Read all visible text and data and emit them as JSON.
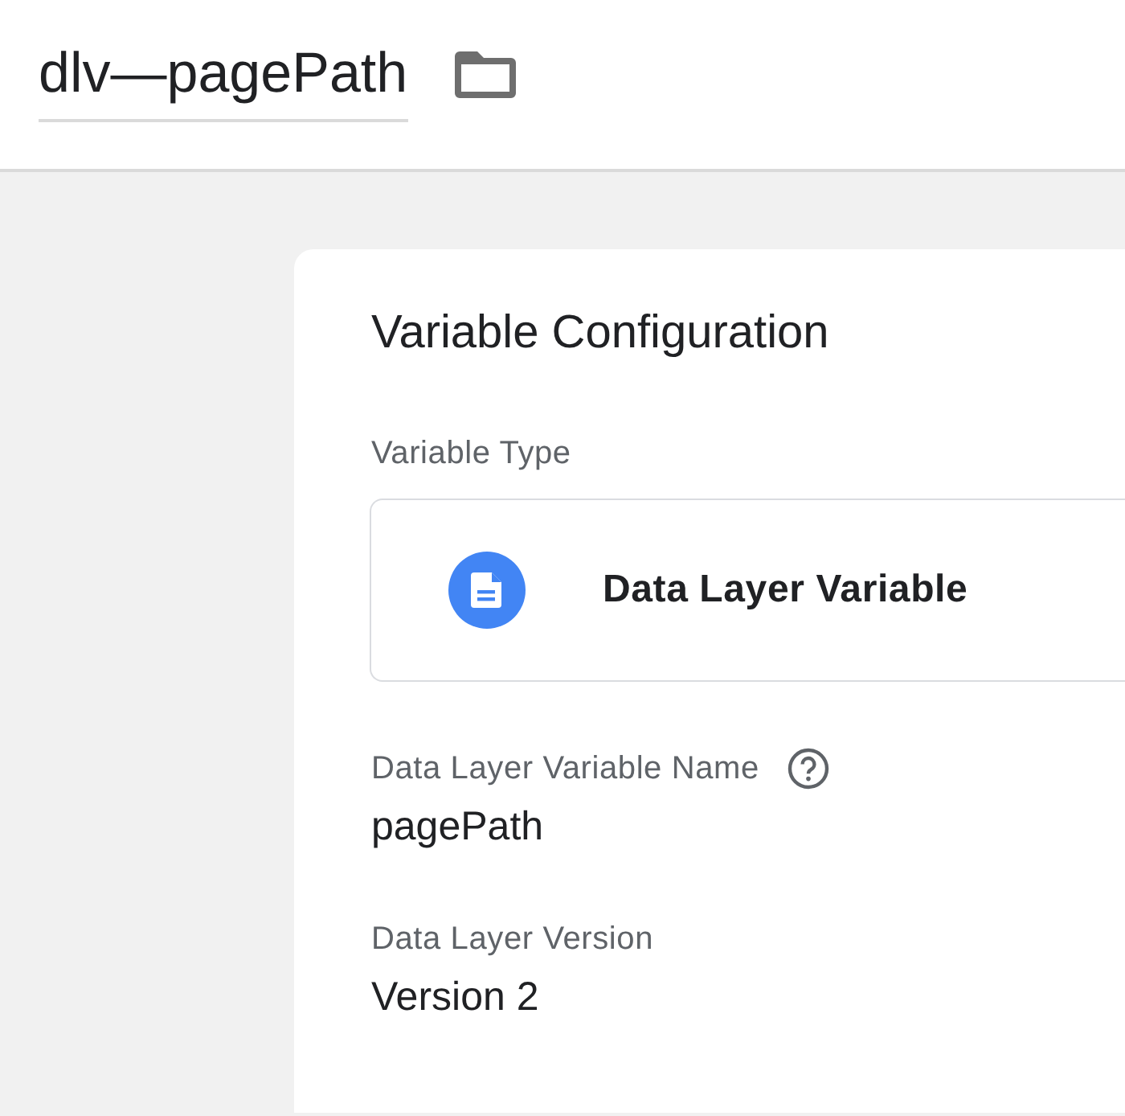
{
  "header": {
    "name_field": "dlv—pagePath"
  },
  "card": {
    "title": "Variable Configuration",
    "variable_type": {
      "label": "Variable Type",
      "value": "Data Layer Variable"
    },
    "fields": [
      {
        "label": "Data Layer Variable Name",
        "help": true,
        "value": "pagePath"
      },
      {
        "label": "Data Layer Version",
        "help": false,
        "value": "Version 2"
      }
    ]
  }
}
